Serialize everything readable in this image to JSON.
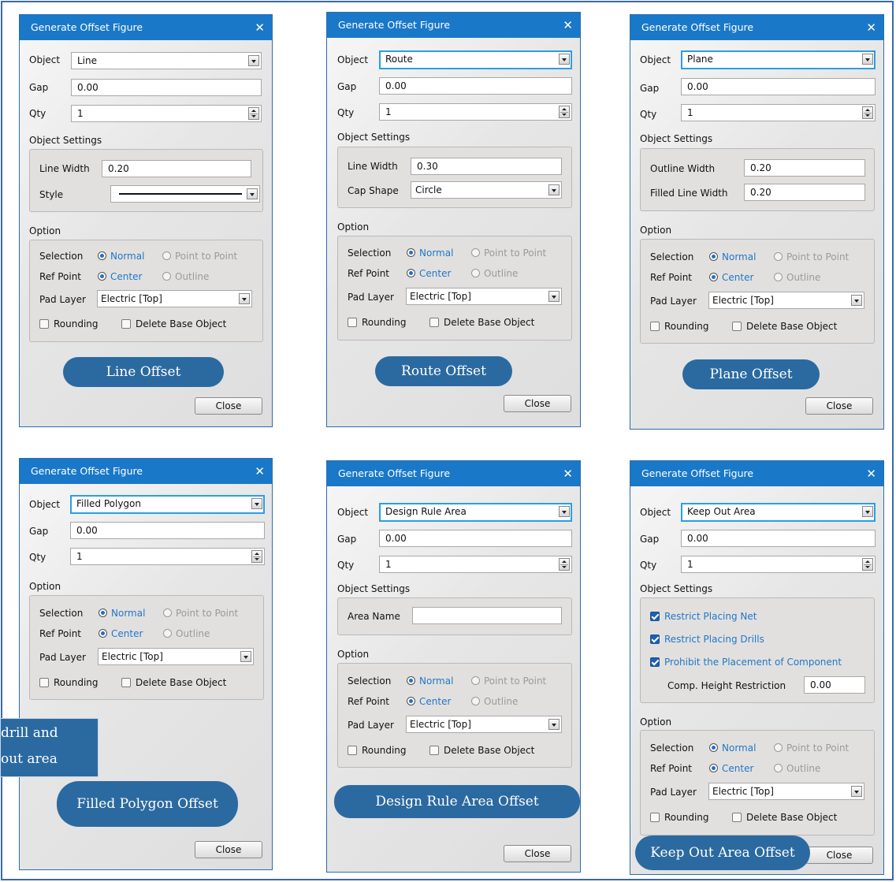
{
  "common": {
    "title": "Generate Offset Figure",
    "close_x": "✕",
    "labels": {
      "object": "Object",
      "gap": "Gap",
      "qty": "Qty",
      "object_settings": "Object Settings",
      "option": "Option",
      "selection": "Selection",
      "ref_point": "Ref Point",
      "pad_layer": "Pad Layer"
    },
    "radio": {
      "normal": "Normal",
      "point_to_point": "Point to Point",
      "center": "Center",
      "outline": "Outline"
    },
    "checkbox": {
      "rounding": "Rounding",
      "delete_base": "Delete Base Object"
    },
    "gap_value": "0.00",
    "qty_value": "1",
    "pad_layer_value": "Electric [Top]",
    "close_button": "Close"
  },
  "line": {
    "object": "Line",
    "line_width_label": "Line Width",
    "line_width": "0.20",
    "style_label": "Style",
    "caption": "Line Offset"
  },
  "route": {
    "object": "Route",
    "line_width_label": "Line Width",
    "line_width": "0.30",
    "cap_shape_label": "Cap Shape",
    "cap_shape": "Circle",
    "caption": "Route Offset"
  },
  "plane": {
    "object": "Plane",
    "outline_width_label": "Outline Width",
    "outline_width": "0.20",
    "filled_width_label": "Filled Line Width",
    "filled_width": "0.20",
    "caption": "Plane Offset"
  },
  "polygon": {
    "object": "Filled Polygon",
    "caption": "Filled Polygon Offset",
    "callout_line1": "drill and",
    "callout_line2": "out area"
  },
  "drarea": {
    "object": "Design Rule Area",
    "area_name_label": "Area Name",
    "area_name": "",
    "caption": "Design Rule Area Offset"
  },
  "keepout": {
    "object": "Keep Out Area",
    "restrict_net": "Restrict Placing Net",
    "restrict_drills": "Restrict Placing Drills",
    "prohibit_component": "Prohibit the Placement of Component",
    "comp_height_label": "Comp. Height Restriction",
    "comp_height": "0.00",
    "caption": "Keep Out Area Offset"
  }
}
